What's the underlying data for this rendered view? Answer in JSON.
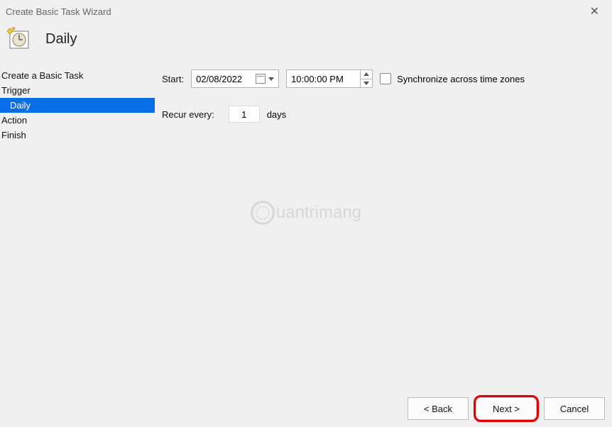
{
  "titlebar": {
    "title": "Create Basic Task Wizard"
  },
  "header": {
    "page_title": "Daily"
  },
  "sidebar": {
    "steps": [
      {
        "label": "Create a Basic Task",
        "indent": false,
        "selected": false
      },
      {
        "label": "Trigger",
        "indent": false,
        "selected": false
      },
      {
        "label": "Daily",
        "indent": true,
        "selected": true
      },
      {
        "label": "Action",
        "indent": false,
        "selected": false
      },
      {
        "label": "Finish",
        "indent": false,
        "selected": false
      }
    ]
  },
  "form": {
    "start_label": "Start:",
    "date_value": "02/08/2022",
    "time_value": "10:00:00 PM",
    "sync_label": "Synchronize across time zones",
    "recur_label": "Recur every:",
    "recur_value": "1",
    "recur_unit": "days"
  },
  "footer": {
    "back": "< Back",
    "next": "Next >",
    "cancel": "Cancel"
  },
  "watermark": "uantrimang"
}
